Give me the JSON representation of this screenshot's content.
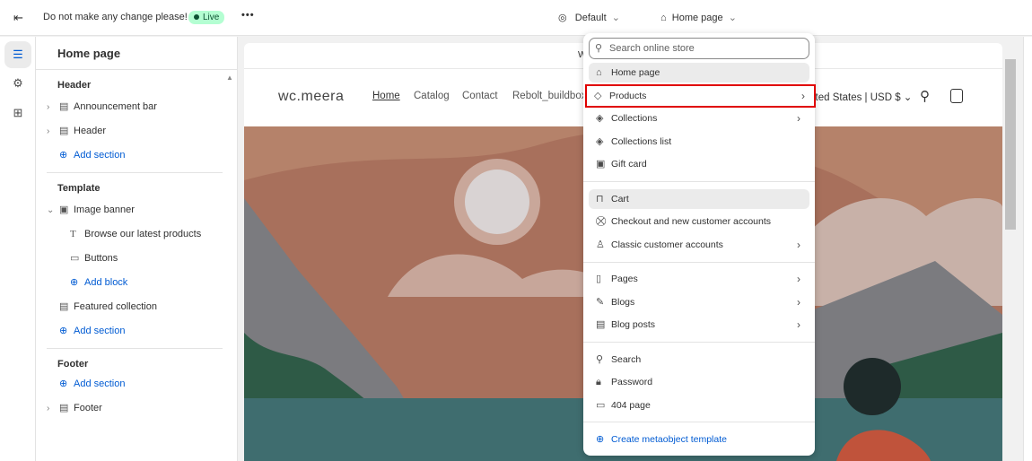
{
  "topbar": {
    "exit_icon": "exit-icon",
    "store_note": "Do not make any change please!",
    "live_badge": "Live",
    "more": "•••",
    "theme": "Default",
    "page": "Home page"
  },
  "rail": [
    "sections-icon",
    "settings-icon",
    "apps-icon"
  ],
  "sidebar": {
    "title": "Home page",
    "header_group": "Header",
    "announcement_bar": "Announcement bar",
    "header": "Header",
    "add_section": "Add section",
    "template_group": "Template",
    "image_banner": "Image banner",
    "browse_text": "Browse our latest products",
    "buttons": "Buttons",
    "add_block": "Add block",
    "featured_collection": "Featured collection",
    "footer_group": "Footer",
    "footer": "Footer"
  },
  "preview": {
    "announcement": "W",
    "logo": "wc.meera",
    "nav": [
      "Home",
      "Catalog",
      "Contact",
      "Rebolt_buildbox"
    ],
    "locale": "ited States | USD $"
  },
  "menu": {
    "search_placeholder": "Search online store",
    "items": [
      "Home page",
      "Products",
      "Collections",
      "Collections list",
      "Gift card",
      "Cart",
      "Checkout and new customer accounts",
      "Classic customer accounts",
      "Pages",
      "Blogs",
      "Blog posts",
      "Search",
      "Password",
      "404 page"
    ],
    "create": "Create metaobject template"
  },
  "colors": {
    "accent": "#005bd3",
    "highlight": "#e00000",
    "live": "#b4fed2"
  }
}
